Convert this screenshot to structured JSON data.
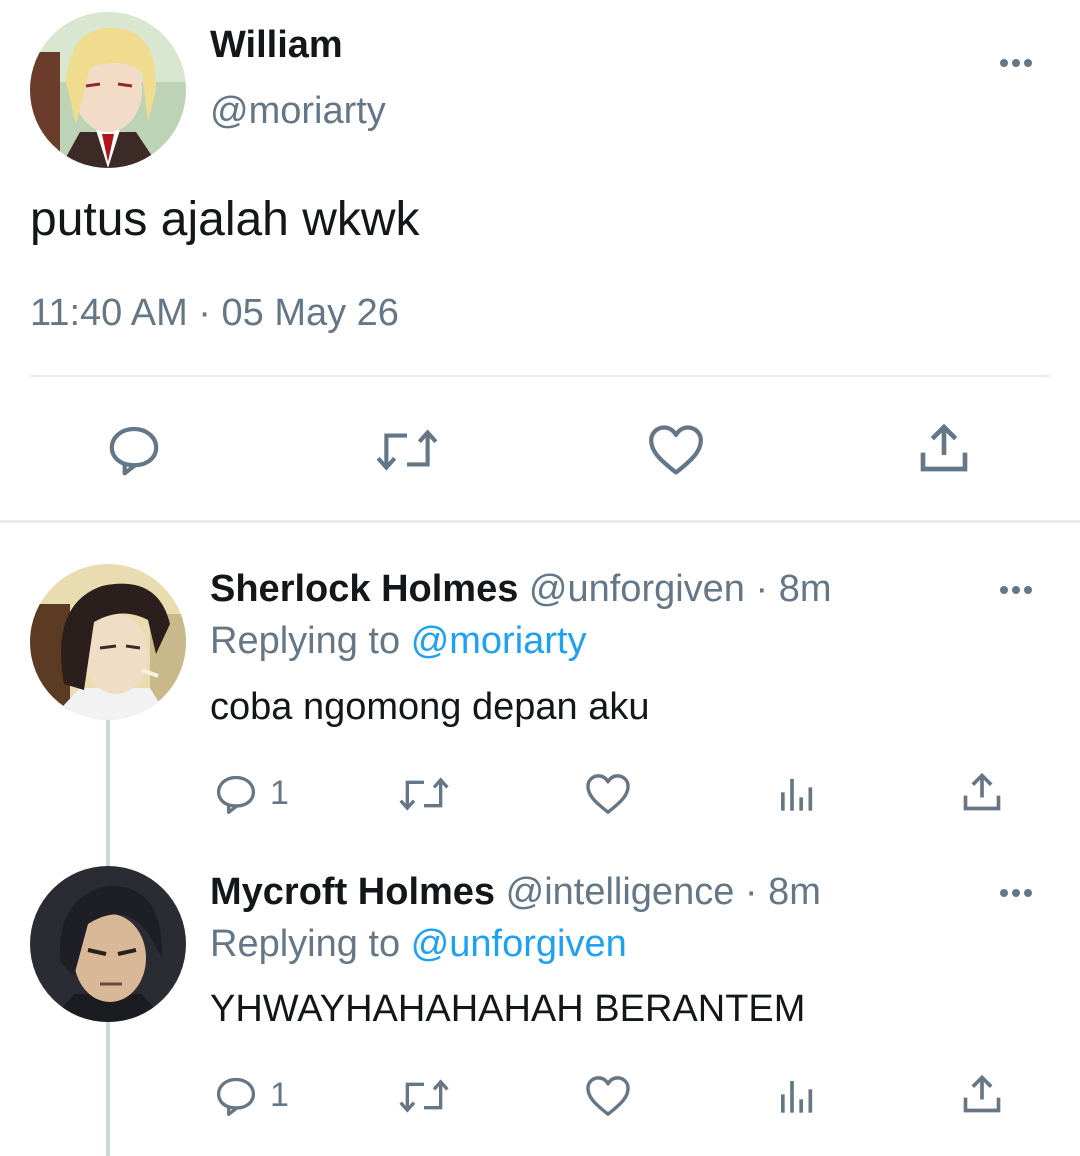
{
  "main_tweet": {
    "display_name": "William",
    "handle": "@moriarty",
    "text": "putus ajalah wkwk",
    "timestamp": "11:40 AM · 05 May 26"
  },
  "replies": [
    {
      "display_name": "Sherlock Holmes",
      "meta": "@unforgiven · 8m",
      "replying_prefix": "Replying to",
      "replying_to": "@moriarty",
      "text": "coba ngomong depan aku",
      "reply_count": "1"
    },
    {
      "display_name": "Mycroft Holmes",
      "meta": "@intelligence · 8m",
      "replying_prefix": "Replying to",
      "replying_to": "@unforgiven",
      "text": "YHWAYHAHAHAHAH BERANTEM",
      "reply_count": "1"
    }
  ],
  "icons": [
    "reply-icon",
    "retweet-icon",
    "like-icon",
    "share-icon",
    "analytics-icon",
    "more-icon"
  ],
  "colors": {
    "text": "#14171a",
    "muted": "#657786",
    "link": "#1da1f2",
    "divider": "#e6ecf0"
  }
}
